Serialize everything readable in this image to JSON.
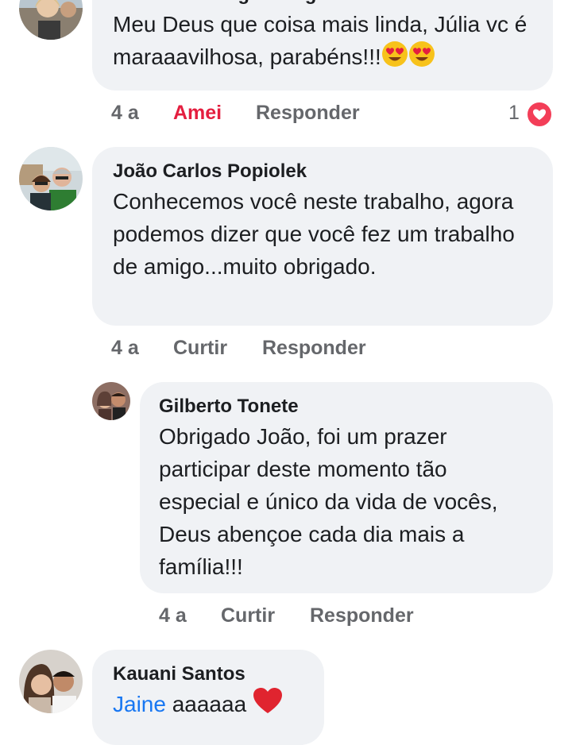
{
  "comments": [
    {
      "author": "Eliane Limberger D'Agostini",
      "text": "Meu Deus que coisa mais linda, Júlia vc é maraaavilhosa, parabéns!!!",
      "emoji": [
        "heart-eyes-emoji",
        "heart-eyes-emoji"
      ],
      "time": "4 a",
      "reaction_label": "Amei",
      "reply_label": "Responder",
      "reaction_count": "1",
      "reaction_icon": "love-reaction-icon"
    },
    {
      "author": "João Carlos Popiolek",
      "text": "Conhecemos você neste trabalho, agora podemos dizer que você fez um trabalho de amigo...muito obrigado.",
      "time": "4 a",
      "like_label": "Curtir",
      "reply_label": "Responder",
      "replies": [
        {
          "author": "Gilberto Tonete",
          "text": "Obrigado João, foi um prazer participar deste momento tão especial e único da vida de vocês, Deus abençoe cada dia mais a família!!!",
          "time": "4 a",
          "like_label": "Curtir",
          "reply_label": "Responder"
        }
      ]
    },
    {
      "author": "Kauani Santos",
      "mention": "Jaine",
      "text": "aaaaaa",
      "emoji": "red-heart-emoji"
    }
  ],
  "colors": {
    "bubble": "#f0f2f5",
    "action_text": "#65676b",
    "love_red": "#e41e3f",
    "mention_blue": "#1877f2"
  }
}
